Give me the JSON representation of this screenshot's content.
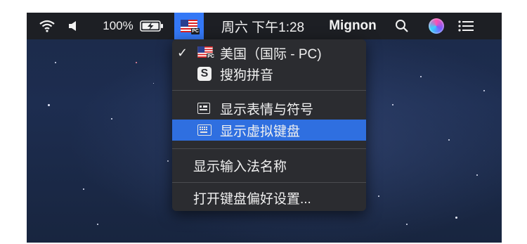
{
  "menubar": {
    "wifi_icon": "wifi-icon",
    "volume_icon": "volume-icon",
    "battery_percent": "100%",
    "battery_icon": "battery-charging-icon",
    "input_flag_icon": "us-pc-flag-icon",
    "flag_badge": "PC",
    "datetime": "周六 下午1:28",
    "username": "Mignon",
    "search_icon": "search-icon",
    "siri_icon": "siri-icon",
    "list_icon": "notification-center-icon"
  },
  "input_menu": {
    "items": [
      {
        "label": "美国（国际 - PC)",
        "checked": true,
        "icon": "us-pc-flag-icon",
        "badge": "PC"
      },
      {
        "label": "搜狗拼音",
        "icon": "sogou-icon",
        "glyph": "S"
      },
      {
        "label": "显示表情与符号",
        "icon": "emoji-symbols-icon"
      },
      {
        "label": "显示虚拟键盘",
        "icon": "keyboard-icon",
        "highlighted": true
      },
      {
        "label": "显示输入法名称"
      },
      {
        "label": "打开键盘偏好设置..."
      }
    ],
    "check_mark": "✓"
  },
  "colors": {
    "menubar_bg": "#1d1f24",
    "menu_bg": "#2b2c30",
    "highlight": "#2f6fe0",
    "desktop": "#1c2a49"
  }
}
